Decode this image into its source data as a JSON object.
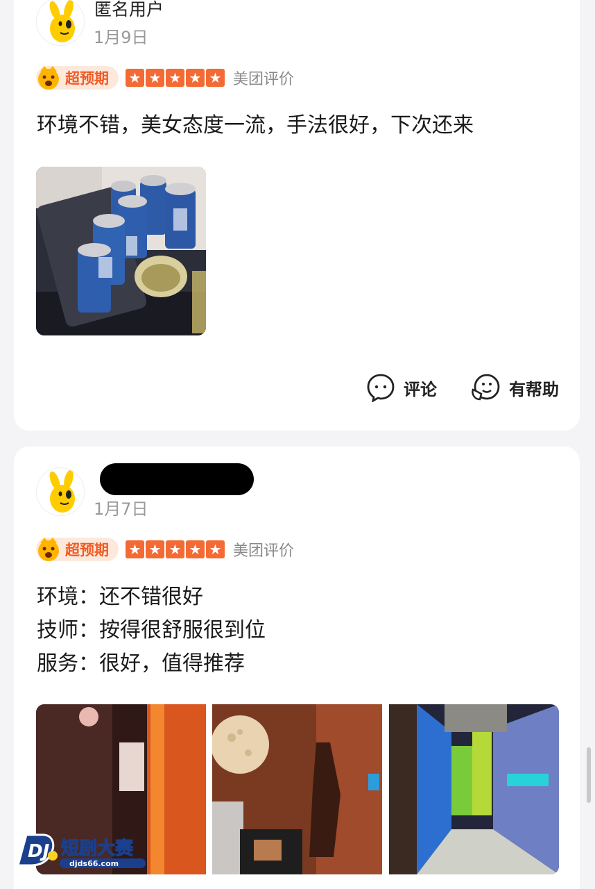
{
  "review1": {
    "username": "匿名用户",
    "date": "1月9日",
    "badge": "超预期",
    "source": "美团评价",
    "text": "环境不错，美女态度一流，手法很好，下次还来",
    "actions": {
      "comment": "评论",
      "helpful": "有帮助"
    },
    "rating": 5
  },
  "review2": {
    "date": "1月7日",
    "badge": "超预期",
    "source": "美团评价",
    "lines": [
      "环境：还不错很好",
      "技师：按得很舒服很到位",
      "服务：很好，值得推荐"
    ],
    "rating": 5
  },
  "watermark": {
    "title": "短剧大赛",
    "url": "djds66.com"
  },
  "colors": {
    "accent": "#f46a34",
    "badge_bg": "#fde9dc",
    "badge_text": "#f15a24"
  }
}
